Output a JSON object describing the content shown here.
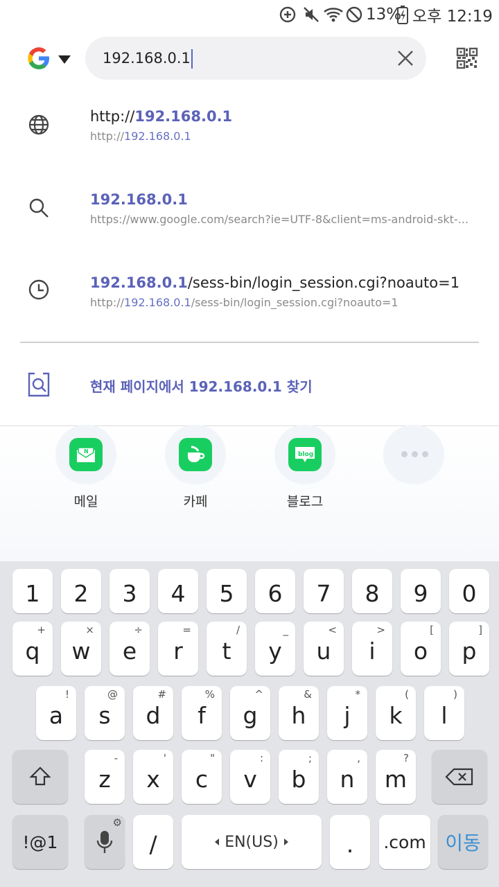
{
  "status_bar": {
    "battery": "13%",
    "time": "오후 12:19"
  },
  "address_bar": {
    "engine_icon": "google-g-icon",
    "value": "192.168.0.1"
  },
  "suggestions": [
    {
      "icon": "globe-icon",
      "line1_prefix": "http://",
      "line1_highlight": "192.168.0.1",
      "line1_suffix": "",
      "line2_prefix": "http://",
      "line2_highlight": "192.168.0.1",
      "line2_suffix": ""
    },
    {
      "icon": "search-icon",
      "line1_prefix": "",
      "line1_highlight": "192.168.0.1",
      "line1_suffix": "",
      "line2_prefix": "https://www.google.com/search?ie=UTF-8&client=ms-android-skt-...",
      "line2_highlight": "",
      "line2_suffix": ""
    },
    {
      "icon": "clock-icon",
      "line1_prefix": "",
      "line1_highlight": "192.168.0.1",
      "line1_suffix": "/sess-bin/login_session.cgi?noauto=1",
      "line2_prefix": "http://",
      "line2_highlight": "192.168.0.1",
      "line2_suffix": "/sess-bin/login_session.cgi?noauto=1"
    }
  ],
  "find_in_page": "현재 페이지에서 192.168.0.1 찾기",
  "shortcuts": [
    {
      "label": "메일",
      "icon": "naver-mail-icon"
    },
    {
      "label": "카페",
      "icon": "naver-cafe-icon"
    },
    {
      "label": "블로그",
      "icon": "naver-blog-icon",
      "badge": "blog"
    },
    {
      "label": "",
      "icon": "more-dots-icon"
    }
  ],
  "keyboard": {
    "number_row": [
      "1",
      "2",
      "3",
      "4",
      "5",
      "6",
      "7",
      "8",
      "9",
      "0"
    ],
    "row1": [
      {
        "k": "q",
        "s": "+"
      },
      {
        "k": "w",
        "s": "×"
      },
      {
        "k": "e",
        "s": "÷"
      },
      {
        "k": "r",
        "s": "="
      },
      {
        "k": "t",
        "s": "/"
      },
      {
        "k": "y",
        "s": "_"
      },
      {
        "k": "u",
        "s": "<"
      },
      {
        "k": "i",
        "s": ">"
      },
      {
        "k": "o",
        "s": "["
      },
      {
        "k": "p",
        "s": "]"
      }
    ],
    "row2": [
      {
        "k": "a",
        "s": "!"
      },
      {
        "k": "s",
        "s": "@"
      },
      {
        "k": "d",
        "s": "#"
      },
      {
        "k": "f",
        "s": "%"
      },
      {
        "k": "g",
        "s": "^"
      },
      {
        "k": "h",
        "s": "&"
      },
      {
        "k": "j",
        "s": "*"
      },
      {
        "k": "k",
        "s": "("
      },
      {
        "k": "l",
        "s": ")"
      }
    ],
    "row3": [
      {
        "k": "z",
        "s": "-"
      },
      {
        "k": "x",
        "s": "'"
      },
      {
        "k": "c",
        "s": "\""
      },
      {
        "k": "v",
        "s": ":"
      },
      {
        "k": "b",
        "s": ";"
      },
      {
        "k": "n",
        "s": ","
      },
      {
        "k": "m",
        "s": "?"
      }
    ],
    "symbols": "!@1",
    "slash": "/",
    "space": "EN(US)",
    "period": ".",
    "dotcom": ".com",
    "go": "이동"
  },
  "colors": {
    "highlight": "#5b62b8",
    "naver_green": "#19ce60",
    "go_blue": "#3d8fd1"
  }
}
